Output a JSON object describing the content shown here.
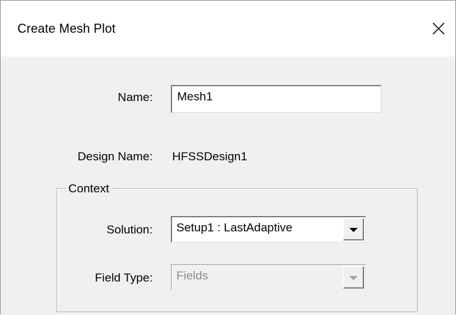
{
  "window": {
    "title": "Create Mesh Plot"
  },
  "form": {
    "name_label": "Name:",
    "name_value": "Mesh1",
    "design_name_label": "Design Name:",
    "design_name_value": "HFSSDesign1"
  },
  "context": {
    "legend": "Context",
    "solution_label": "Solution:",
    "solution_value": "Setup1 : LastAdaptive",
    "field_type_label": "Field Type:",
    "field_type_value": "Fields",
    "field_type_disabled": true
  },
  "icons": {
    "close": "close-icon",
    "dropdown": "chevron-down-icon"
  }
}
